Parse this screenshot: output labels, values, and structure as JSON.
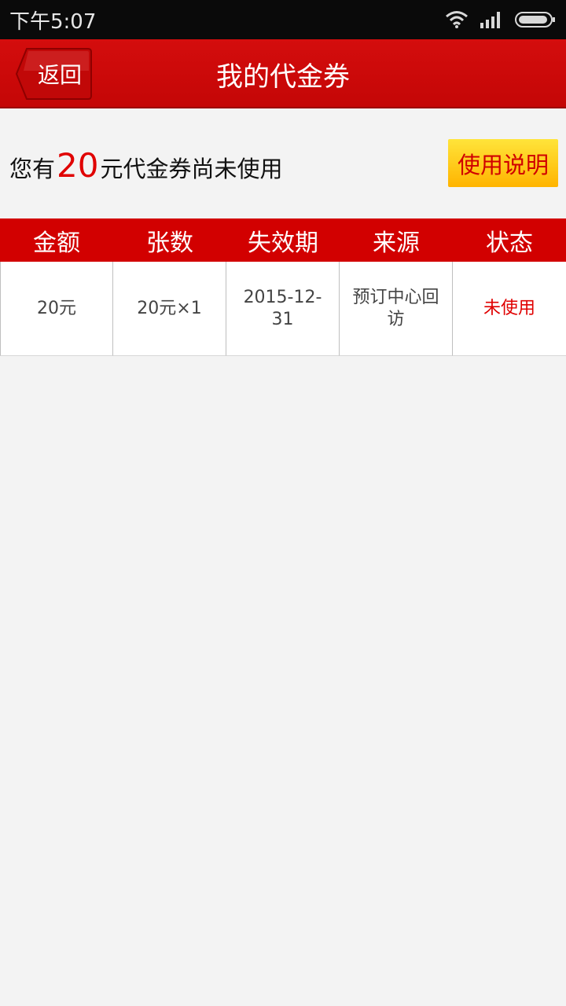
{
  "status_bar": {
    "time": "下午5:07",
    "icons": [
      "wifi-icon",
      "signal-icon",
      "battery-icon"
    ]
  },
  "header": {
    "back_label": "返回",
    "title": "我的代金券"
  },
  "summary": {
    "prefix": "您有",
    "amount": "20",
    "suffix": "元代金券尚未使用",
    "help_label": "使用说明"
  },
  "table": {
    "columns": [
      "金额",
      "张数",
      "失效期",
      "来源",
      "状态"
    ],
    "rows": [
      {
        "amount": "20元",
        "count": "20元×1",
        "expiry": "2015-12-31",
        "source": "预订中心回访",
        "status": "未使用"
      }
    ]
  },
  "colors": {
    "brand_red": "#d20000",
    "help_yellow": "#ffc400",
    "highlight_red": "#e00000"
  }
}
